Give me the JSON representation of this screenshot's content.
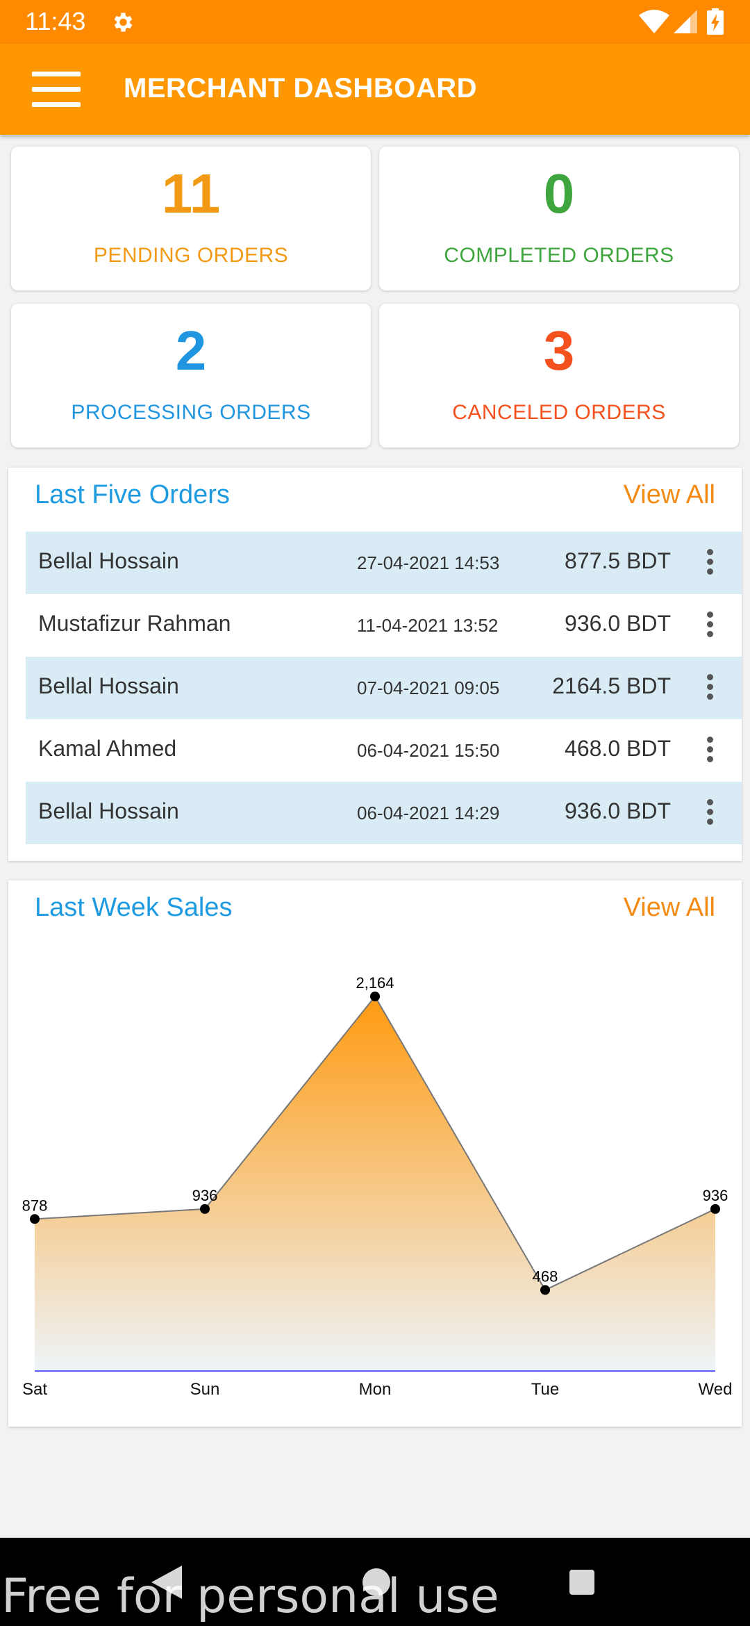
{
  "status_bar": {
    "time": "11:43",
    "icons": [
      "gear-icon",
      "wifi-icon",
      "signal-icon",
      "battery-charging-icon"
    ]
  },
  "app_bar": {
    "title": "MERCHANT DASHBOARD",
    "menu_icon": "hamburger-menu-icon"
  },
  "stats": {
    "pending": {
      "count": "11",
      "label": "PENDING ORDERS",
      "color": "#f29a16"
    },
    "completed": {
      "count": "0",
      "label": "COMPLETED ORDERS",
      "color": "#3fa63f"
    },
    "processing": {
      "count": "2",
      "label": "PROCESSING ORDERS",
      "color": "#2196e0"
    },
    "canceled": {
      "count": "3",
      "label": "CANCELED ORDERS",
      "color": "#f4511e"
    }
  },
  "last_orders": {
    "title": "Last Five Orders",
    "view_all": "View All",
    "rows": [
      {
        "name": "Bellal Hossain",
        "date": "27-04-2021 14:53",
        "amount": "877.5 BDT"
      },
      {
        "name": "Mustafizur Rahman",
        "date": "11-04-2021 13:52",
        "amount": "936.0 BDT"
      },
      {
        "name": "Bellal Hossain",
        "date": "07-04-2021 09:05",
        "amount": "2164.5 BDT"
      },
      {
        "name": "Kamal Ahmed",
        "date": "06-04-2021 15:50",
        "amount": "468.0 BDT"
      },
      {
        "name": "Bellal Hossain",
        "date": "06-04-2021 14:29",
        "amount": "936.0 BDT"
      }
    ],
    "row_menu_icon": "more-vertical-icon"
  },
  "weekly_sales": {
    "title": "Last Week Sales",
    "view_all": "View All"
  },
  "chart_data": {
    "type": "area",
    "categories": [
      "Sat",
      "Sun",
      "Mon",
      "Tue",
      "Wed"
    ],
    "values": [
      878,
      936,
      2164,
      468,
      936
    ],
    "value_labels": [
      "878",
      "936",
      "2,164",
      "468",
      "936"
    ],
    "title": "",
    "xlabel": "",
    "ylabel": "",
    "ylim": [
      0,
      2164
    ],
    "grid": false,
    "legend": "none",
    "colors": {
      "fill_top": "#ff9a10",
      "fill_bottom": "#eef4f8",
      "line": "#777777",
      "point": "#000000",
      "baseline": "#5b5bff"
    }
  },
  "nav_bar": {
    "icons": [
      "back-icon",
      "home-icon",
      "recents-icon"
    ]
  },
  "watermark": "Free for personal use",
  "theme": {
    "primary": "#ff9800",
    "status_bar": "#ff8a00",
    "accent_blue": "#1e9be0",
    "accent_orange": "#f28a14"
  }
}
